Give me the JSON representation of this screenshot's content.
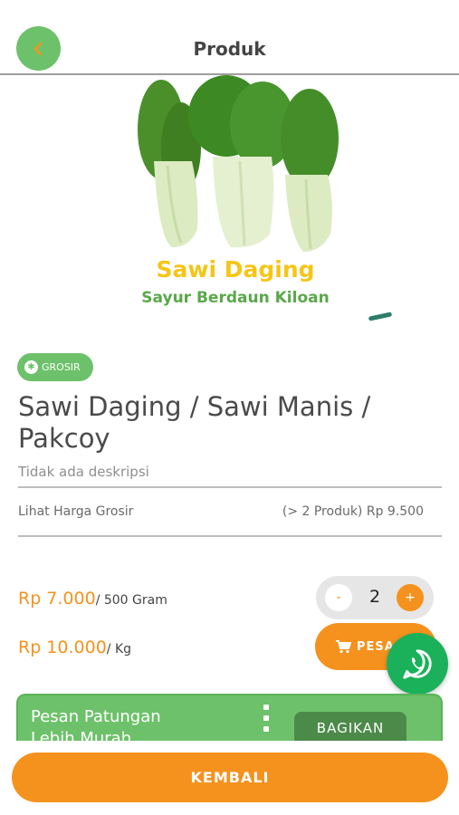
{
  "header": {
    "title": "Produk",
    "back_icon": "chevron-left-icon"
  },
  "image": {
    "title": "Sawi Daging",
    "subtitle": "Sayur Berdaun Kiloan"
  },
  "product": {
    "badge": "GROSIR",
    "name": "Sawi Daging / Sawi Manis / Pakcoy",
    "description": "Tidak ada deskripsi"
  },
  "wholesale": {
    "link_label": "Lihat Harga Grosir",
    "price_info": "(> 2 Produk) Rp 9.500"
  },
  "prices": [
    {
      "price": "Rp 7.000",
      "unit": "/ 500 Gram"
    },
    {
      "price": "Rp 10.000",
      "unit": "/ Kg"
    }
  ],
  "quantity": {
    "minus": "-",
    "value": "2",
    "plus": "+"
  },
  "order_button": {
    "label": "PESA"
  },
  "group_buy": {
    "text_line1": "Pesan Patungan",
    "text_line2": "Lebih Murah",
    "share_label": "BAGIKAN"
  },
  "footer": {
    "back_label": "KEMBALI"
  },
  "colors": {
    "green": "#6dc16a",
    "orange": "#f5921e",
    "whatsapp": "#1ab15a"
  }
}
